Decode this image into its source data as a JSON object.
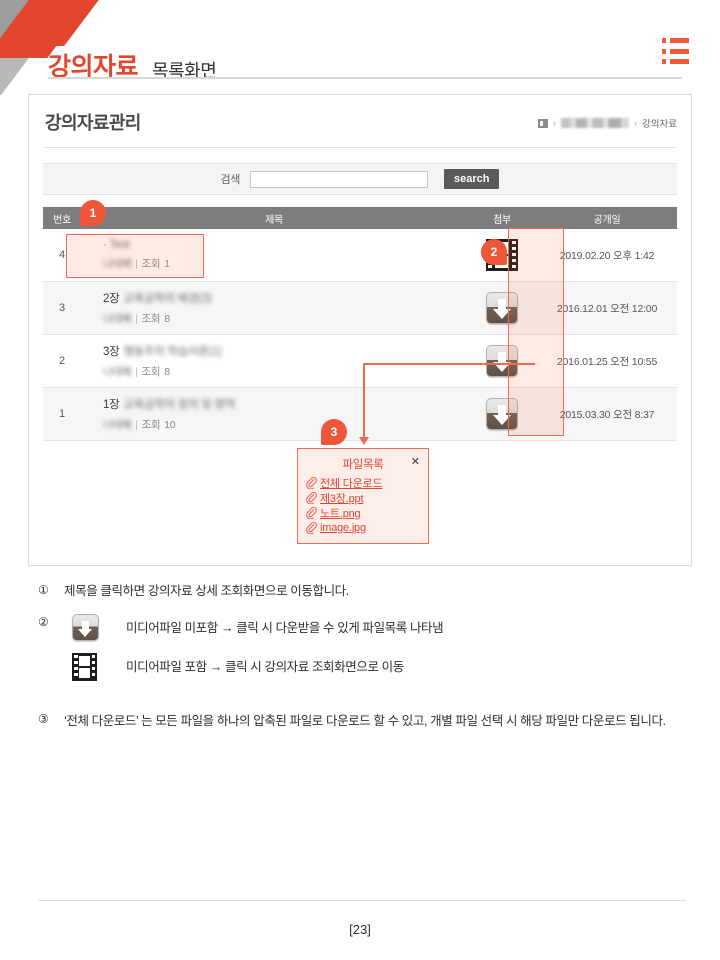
{
  "header": {
    "title_main": "강의자료",
    "title_sub": "목록화면",
    "list_icon": "list-icon"
  },
  "panel": {
    "title": "강의자료관리",
    "breadcrumb": {
      "home_icon": "home-icon",
      "separator": "›",
      "redacted_item": "",
      "current": "강의자료"
    },
    "search": {
      "label": "검색",
      "value": "",
      "placeholder": "",
      "button_label": "search"
    },
    "table": {
      "columns": [
        "번호",
        "제목",
        "첨부",
        "공개일"
      ],
      "rows": [
        {
          "no": "4",
          "title": "Test",
          "title_redacted": true,
          "author": "나대혜",
          "author_redacted": true,
          "views_label": "조회",
          "views": "1",
          "attachment_icon": "film-icon",
          "date": "2019.02.20 오후 1:42"
        },
        {
          "no": "3",
          "title": "2장 교육공학의 배경(3)",
          "title_redacted": true,
          "author": "나대혜",
          "author_redacted": true,
          "views_label": "조회",
          "views": "8",
          "attachment_icon": "download-icon",
          "date": "2016.12.01 오전 12:00"
        },
        {
          "no": "2",
          "title": "3장 행동주의 학습이론(1)",
          "title_redacted": true,
          "author": "나대혜",
          "author_redacted": true,
          "views_label": "조회",
          "views": "8",
          "attachment_icon": "download-icon",
          "date": "2016.01.25 오전 10:55"
        },
        {
          "no": "1",
          "title": "1장 교육공학의 정의 및 영역",
          "title_redacted": true,
          "author": "나대혜",
          "author_redacted": true,
          "views_label": "조회",
          "views": "10",
          "attachment_icon": "download-icon",
          "date": "2015.03.30 오전 8:37"
        }
      ]
    }
  },
  "popup": {
    "title": "파일목록",
    "close_label": "✕",
    "files": [
      {
        "label": "전체 다운로드",
        "icon": "paperclip-icon"
      },
      {
        "label": "제3장.ppt",
        "icon": "paperclip-icon"
      },
      {
        "label": "노트.png",
        "icon": "paperclip-icon"
      },
      {
        "label": "image.jpg",
        "icon": "paperclip-icon"
      }
    ]
  },
  "annotations": {
    "badge1": "1",
    "badge2": "2",
    "badge3": "3",
    "accent_color": "#f0573a"
  },
  "notes": {
    "n1_num": "①",
    "n1_text": "제목을 클릭하면 강의자료 상세 조회화면으로 이동합니다.",
    "n2_num": "②",
    "n2_line1": "미디어파일 미포함 → 클릭 시 다운받을 수 있게 파일목록 나타냄",
    "n2_line2": "미디어파일 포함 → 클릭 시 강의자료 조회화면으로 이동",
    "n3_num": "③",
    "n3_text": "‘전체 다운로드’ 는 모든 파일을 하나의 압축된 파일로 다운로드 할 수 있고, 개별 파일 선택 시 해당 파일만 다운로드 됩니다."
  },
  "footer": {
    "page": "[23]"
  }
}
